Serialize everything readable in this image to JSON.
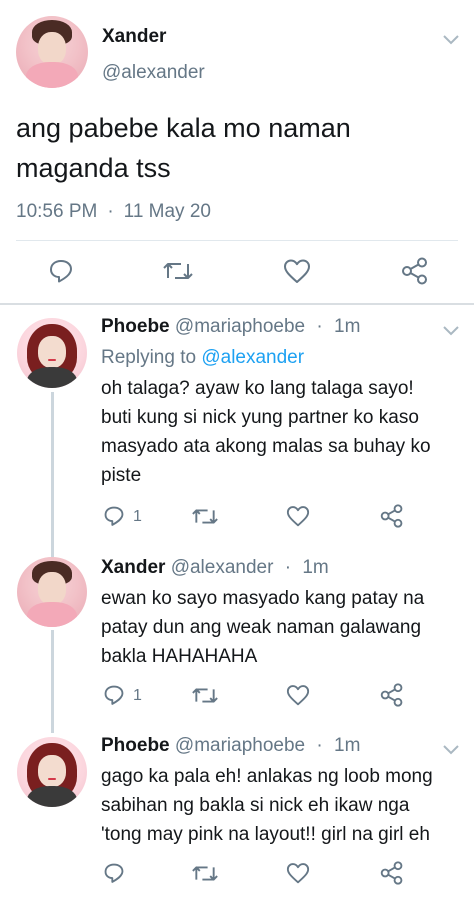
{
  "main_tweet": {
    "name": "Xander",
    "handle": "@alexander",
    "text_line1": "ang pabebe kala mo naman",
    "text_line2": "maganda tss",
    "time": "10:56 PM",
    "separator": "·",
    "date": "11 May 20"
  },
  "replies": [
    {
      "name": "Phoebe",
      "handle": "@mariaphoebe",
      "separator": "·",
      "time": "1m",
      "replying_prefix": "Replying to",
      "replying_to": "@alexander",
      "lines": [
        "oh talaga? ayaw ko lang talaga sayo!",
        "buti kung si nick yung partner ko kaso",
        "masyado ata akong malas sa buhay ko",
        "piste"
      ],
      "reply_count": "1"
    },
    {
      "name": "Xander",
      "handle": "@alexander",
      "separator": "·",
      "time": "1m",
      "lines": [
        "ewan ko sayo masyado kang patay na",
        "patay dun ang weak naman galawang",
        "bakla HAHAHAHA"
      ],
      "reply_count": "1"
    },
    {
      "name": "Phoebe",
      "handle": "@mariaphoebe",
      "separator": "·",
      "time": "1m",
      "lines": [
        "gago ka pala eh! anlakas ng loob mong",
        "sabihan ng bakla si nick eh ikaw nga",
        "'tong may pink na layout!! girl na girl eh"
      ]
    }
  ],
  "icons": {
    "reply": "reply-icon",
    "retweet": "retweet-icon",
    "like": "heart-icon",
    "share": "share-icon",
    "more": "chevron-down-icon"
  },
  "colors": {
    "link": "#1da1f2",
    "secondary_text": "#657786",
    "divider": "#e1e8ed"
  }
}
